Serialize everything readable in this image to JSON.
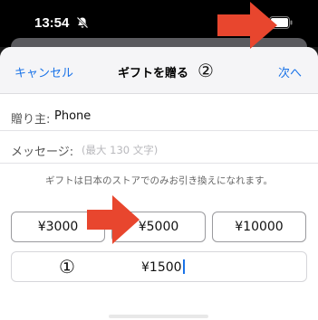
{
  "status_bar": {
    "time": "13:54"
  },
  "nav": {
    "cancel_label": "キャンセル",
    "title": "ギフトを贈る",
    "next_label": "次へ"
  },
  "annotations": {
    "marker_top": "②",
    "marker_bottom": "①",
    "arrow_color": "#e8462e"
  },
  "form": {
    "from_label": "贈り主:",
    "from_value": "Phone",
    "message_label": "メッセージ:",
    "message_placeholder": "(最大 130 文字)"
  },
  "note": "ギフトは日本のストアでのみお引き換えになれます。",
  "amounts": [
    {
      "label": "¥3000"
    },
    {
      "label": "¥5000"
    },
    {
      "label": "¥10000"
    }
  ],
  "custom_amount": {
    "value": "¥1500"
  },
  "colors": {
    "accent": "#1a73e8"
  }
}
